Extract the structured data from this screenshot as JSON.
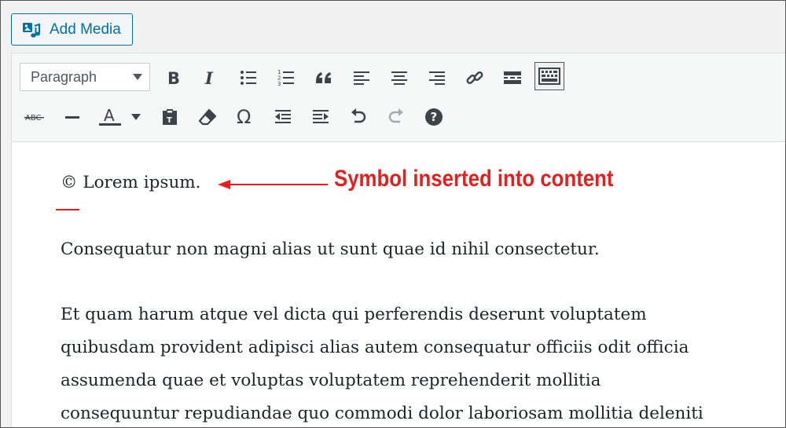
{
  "media": {
    "label": "Add Media",
    "icon": "add-media-icon"
  },
  "toolbar": {
    "format_selected": "Paragraph",
    "row1": [
      "bold",
      "italic",
      "bulleted-list",
      "numbered-list",
      "blockquote",
      "align-left",
      "align-center",
      "align-right",
      "insert-link",
      "read-more",
      "toolbar-toggle"
    ],
    "row2": [
      "strikethrough",
      "horizontal-line",
      "text-color",
      "text-color-dropdown",
      "paste-as-text",
      "clear-formatting",
      "special-character",
      "outdent",
      "indent",
      "undo",
      "redo",
      "keyboard-shortcuts"
    ],
    "strike_glyph": "ABC",
    "textcolor_glyph": "A",
    "omega_glyph": "Ω",
    "help_glyph": "?"
  },
  "content": {
    "symbol": "©",
    "line1_text": " Lorem ipsum.",
    "para2": "Consequatur non magni alias ut sunt quae id nihil consectetur.",
    "para3_lines": [
      "Et quam harum atque vel dicta qui perferendis deserunt voluptatem",
      "quibusdam provident adipisci alias autem consequatur officiis odit officia",
      "assumenda quae et voluptas voluptatem reprehenderit mollitia",
      "consequuntur repudiandae quo commodi dolor laboriosam mollitia deleniti"
    ]
  },
  "annotation": {
    "text": "Symbol inserted into content",
    "color": "#e41f1f"
  },
  "colors": {
    "accent": "#0071a1",
    "icon": "#3c434a",
    "disabled": "#a7aaad"
  }
}
